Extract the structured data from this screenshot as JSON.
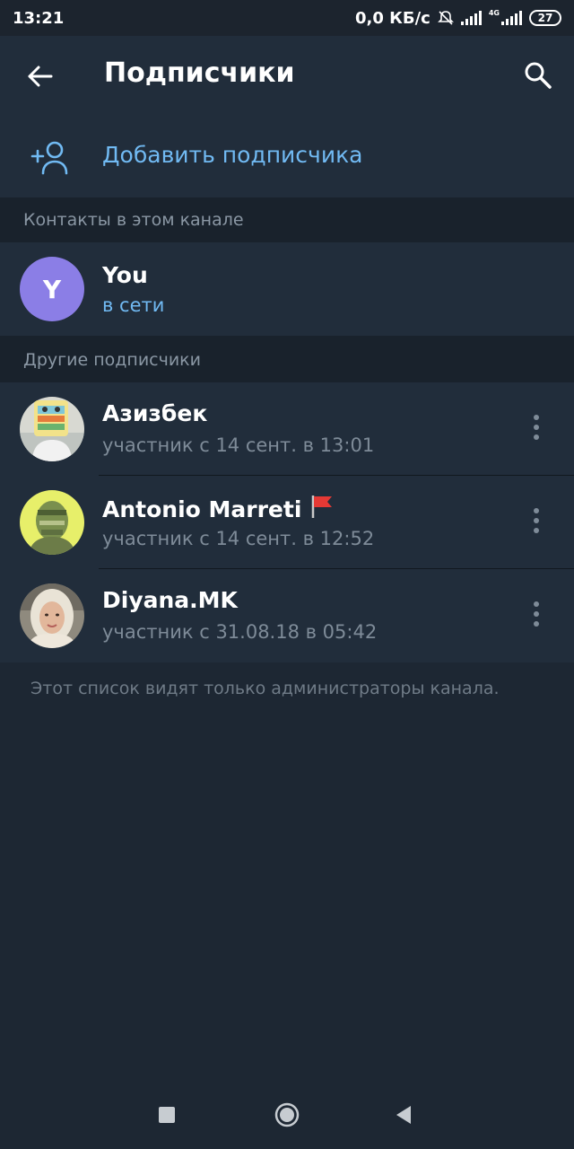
{
  "status_bar": {
    "time": "13:21",
    "network_speed": "0,0 КБ/с",
    "network_type": "4G",
    "battery": "27"
  },
  "header": {
    "title": "Подписчики",
    "back_icon": "arrow-left-icon",
    "search_icon": "search-icon"
  },
  "add_subscriber": {
    "label": "Добавить подписчика",
    "icon": "add-user-icon"
  },
  "sections": {
    "contacts_title": "Контакты в этом канале",
    "others_title": "Другие подписчики"
  },
  "contacts": [
    {
      "name": "You",
      "status": "в сети",
      "avatar_letter": "Y",
      "avatar_color": "#8b7ee6"
    }
  ],
  "subscribers": [
    {
      "name": "Азизбек",
      "status": "участник с 14 сент. в 13:01"
    },
    {
      "name": "Antonio Marreti",
      "status": "участник с 14 сент. в 12:52",
      "badge": "red-flag-icon"
    },
    {
      "name": "Diyana.MK",
      "status": "участник с 31.08.18 в 05:42"
    }
  ],
  "footer_note": "Этот список видят только администраторы канала.",
  "colors": {
    "background": "#1d2733",
    "surface": "#212d3b",
    "accent": "#71baf3",
    "secondary_text": "#7e8b98"
  }
}
